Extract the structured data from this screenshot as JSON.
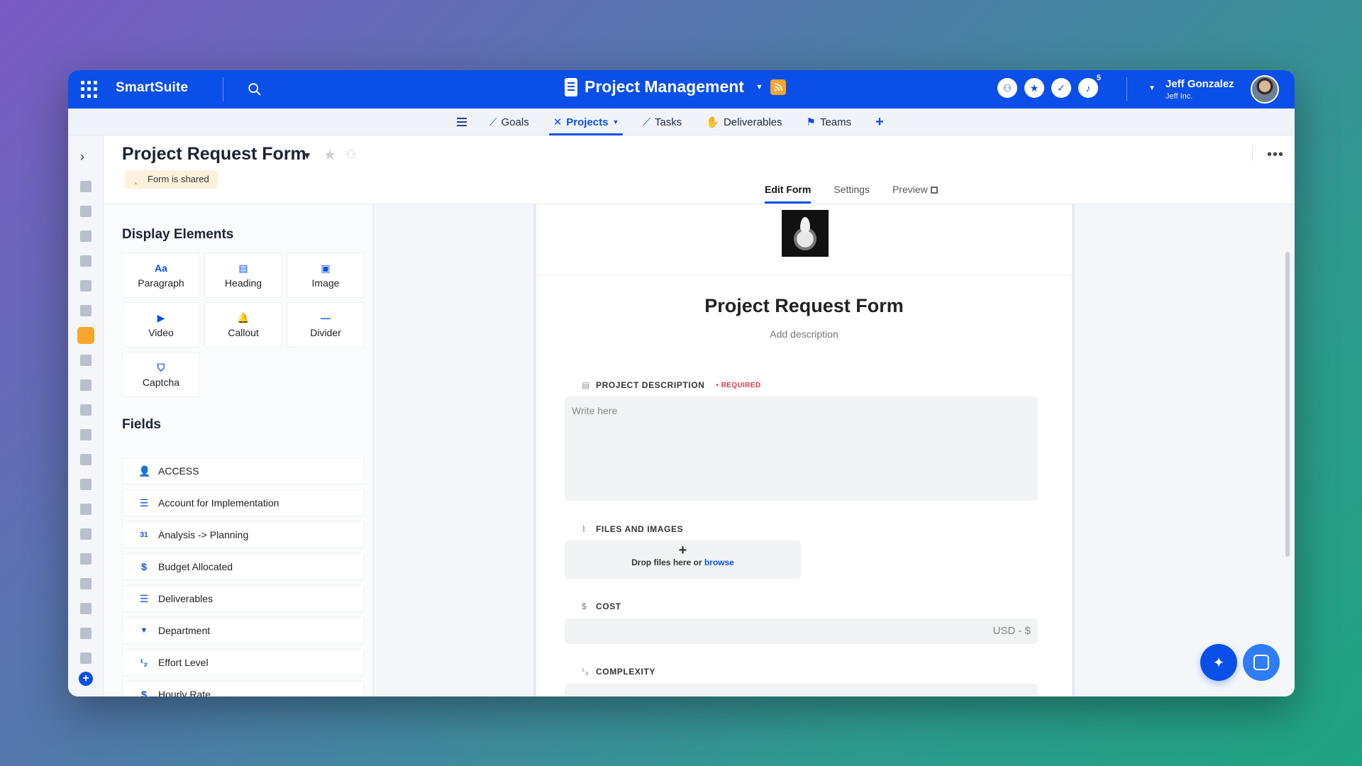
{
  "topbar": {
    "brand": "SmartSuite",
    "title": "Project Management",
    "notification_count": "5",
    "user_name": "Jeff Gonzalez",
    "user_org": "Jeff Inc."
  },
  "nav": {
    "tabs": [
      {
        "label": "Goals",
        "icon": "chart-line-icon"
      },
      {
        "label": "Projects",
        "icon": "tools-icon"
      },
      {
        "label": "Tasks",
        "icon": "chart-line-icon"
      },
      {
        "label": "Deliverables",
        "icon": "hand-icon"
      },
      {
        "label": "Teams",
        "icon": "people-run-icon"
      }
    ],
    "plus": "+"
  },
  "header": {
    "title": "Project Request Form",
    "shared_badge": "Form is shared",
    "form_tabs": [
      "Edit Form",
      "Settings",
      "Preview"
    ]
  },
  "left_panel": {
    "display_title": "Display Elements",
    "display_elements": [
      {
        "label": "Paragraph",
        "icon": "Aa"
      },
      {
        "label": "Heading",
        "icon": "▤"
      },
      {
        "label": "Image",
        "icon": "▣"
      },
      {
        "label": "Video",
        "icon": "▶"
      },
      {
        "label": "Callout",
        "icon": "🔔"
      },
      {
        "label": "Divider",
        "icon": "—"
      },
      {
        "label": "Captcha",
        "icon": "⛉"
      }
    ],
    "fields_title": "Fields",
    "fields": [
      {
        "label": "ACCESS",
        "icon": "👤"
      },
      {
        "label": "Account for Implementation",
        "icon": "☰"
      },
      {
        "label": "Analysis -> Planning",
        "icon": "31"
      },
      {
        "label": "Budget Allocated",
        "icon": "$"
      },
      {
        "label": "Deliverables",
        "icon": "☰"
      },
      {
        "label": "Department",
        "icon": "▼"
      },
      {
        "label": "Effort Level",
        "icon": "¹₂"
      },
      {
        "label": "Hourly Rate",
        "icon": "$"
      }
    ]
  },
  "form": {
    "title": "Project Request Form",
    "description_placeholder": "Add description",
    "q1_label": "PROJECT DESCRIPTION",
    "q1_required": "• REQUIRED",
    "q1_placeholder": "Write here",
    "q2_label": "FILES AND IMAGES",
    "q2_drop": "Drop files here or",
    "q2_browse": "browse",
    "q3_label": "COST",
    "q3_currency": "USD - $",
    "q4_label": "COMPLEXITY"
  },
  "colors": {
    "brand_blue": "#0a4fe8",
    "shared_orange": "#f7a52b",
    "required_red": "#e0384c"
  }
}
